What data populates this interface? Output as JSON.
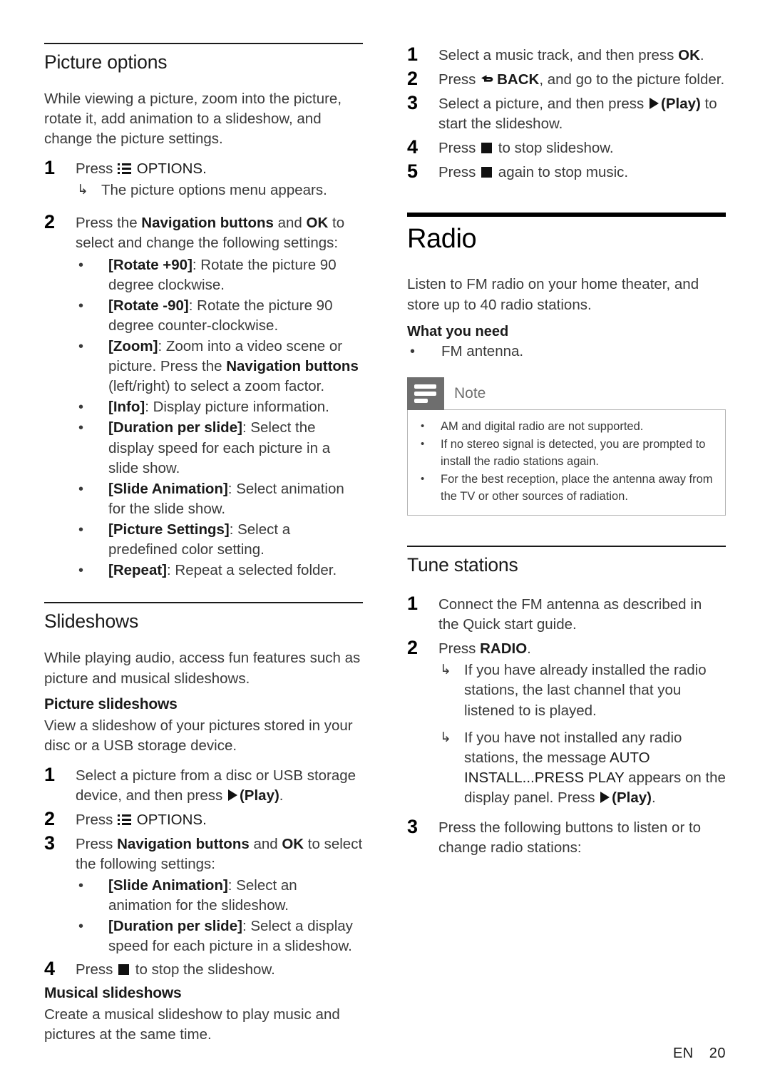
{
  "page": {
    "footer_lang": "EN",
    "footer_page": "20"
  },
  "left_column": {
    "picture_options": {
      "title": "Picture options",
      "intro": "While viewing a picture, zoom into the picture, rotate it, add animation to a slideshow, and change the picture settings.",
      "step1_num": "1",
      "step1_pre": "Press ",
      "step1_post": " OPTIONS.",
      "step1_result_marker": "↳",
      "step1_result": "The picture options menu appears.",
      "step2_num": "2",
      "step2_a": "Press the ",
      "step2_b": "Navigation buttons",
      "step2_c": " and ",
      "step2_d": "OK",
      "step2_e": " to select and change the following settings:",
      "bullet_marker": "•",
      "bullets": [
        {
          "term": "[Rotate +90]",
          "desc": ": Rotate the picture 90 degree clockwise."
        },
        {
          "term": "[Rotate -90]",
          "desc": ": Rotate the picture 90 degree counter-clockwise."
        },
        {
          "term": "[Zoom]",
          "desc": ": Zoom into a video scene or picture. Press the ",
          "bold_mid": "Navigation buttons",
          "desc2": " (left/right) to select a zoom factor."
        },
        {
          "term": "[Info]",
          "desc": ": Display picture information."
        },
        {
          "term": "[Duration per slide]",
          "desc": ": Select the display speed for each picture in a slide show."
        },
        {
          "term": "[Slide Animation]",
          "desc": ": Select animation for the slide show."
        },
        {
          "term": "[Picture Settings]",
          "desc": ": Select a predefined color setting."
        },
        {
          "term": "[Repeat]",
          "desc": ": Repeat a selected folder."
        }
      ]
    },
    "slideshows": {
      "title": "Slideshows",
      "intro": "While playing audio, access fun features such as picture and musical slideshows.",
      "picture_slideshows_title": "Picture slideshows",
      "picture_slideshows_intro": "View a slideshow of your pictures stored in your disc or a USB storage device.",
      "step1_num": "1",
      "step1_a": "Select a picture from a disc or USB storage device, and then press ",
      "step1_b": "(Play)",
      "step1_c": ".",
      "step2_num": "2",
      "step2_pre": "Press ",
      "step2_post": " OPTIONS.",
      "step3_num": "3",
      "step3_a": "Press ",
      "step3_b": "Navigation buttons",
      "step3_c": " and ",
      "step3_d": "OK",
      "step3_e": " to select the following settings:",
      "bullet_marker": "•",
      "bullets": [
        {
          "term": "[Slide Animation]",
          "desc": ": Select an animation for the slideshow."
        },
        {
          "term": "[Duration per slide]",
          "desc": ": Select a display speed for each picture in a slideshow."
        }
      ],
      "step4_num": "4",
      "step4_pre": "Press ",
      "step4_post": " to stop the slideshow.",
      "musical_slideshows_title": "Musical slideshows",
      "musical_slideshows_intro": "Create a musical slideshow to play music and pictures at the same time."
    }
  },
  "right_column": {
    "musical_steps": {
      "step1_num": "1",
      "step1_a": "Select a music track, and then press ",
      "step1_b": "OK",
      "step1_c": ".",
      "step2_num": "2",
      "step2_a": "Press ",
      "step2_b": "BACK",
      "step2_c": ", and go to the picture folder.",
      "step3_num": "3",
      "step3_a": "Select a picture, and then press ",
      "step3_b": "(Play)",
      "step3_c": " to start the slideshow.",
      "step4_num": "4",
      "step4_a": "Press ",
      "step4_b": " to stop slideshow.",
      "step5_num": "5",
      "step5_a": "Press ",
      "step5_b": " again to stop music."
    },
    "radio": {
      "title": "Radio",
      "intro": "Listen to FM radio on your home theater, and store up to 40 radio stations.",
      "what_you_need_title": "What you need",
      "bullet_marker": "•",
      "what_you_need_items": [
        "FM antenna."
      ],
      "note": {
        "label": "Note",
        "icon": "note-lines-icon",
        "bullet_marker": "•",
        "items": [
          "AM and digital radio are not supported.",
          "If no stereo signal is detected, you are prompted to install the radio stations again.",
          "For the best reception, place the antenna away from the TV or other sources of radiation."
        ]
      }
    },
    "tune_stations": {
      "title": "Tune stations",
      "step1_num": "1",
      "step1_text": "Connect the FM antenna as described in the Quick start guide.",
      "step2_num": "2",
      "step2_a": "Press ",
      "step2_b": "RADIO",
      "step2_c": ".",
      "result_marker": "↳",
      "result1": "If you have already installed the radio stations, the last channel that you listened to is played.",
      "result2_a": "If you have not installed any radio stations, the message ",
      "result2_b": "AUTO INSTALL...PRESS PLAY",
      "result2_c": " appears on the display panel. Press ",
      "result2_d": "(Play)",
      "result2_e": ".",
      "step3_num": "3",
      "step3_text": "Press the following buttons to listen or to change radio stations:"
    }
  }
}
